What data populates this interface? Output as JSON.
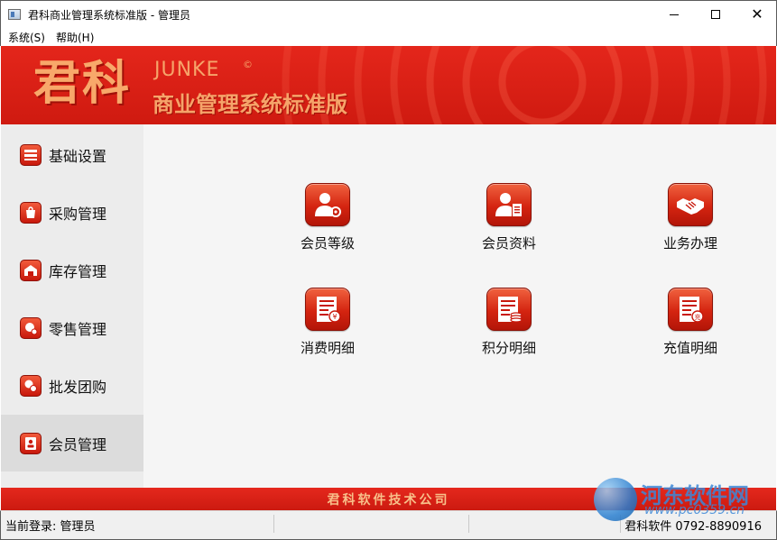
{
  "window": {
    "title": "君科商业管理系统标准版 - 管理员",
    "minimize_icon": "minimize-icon",
    "maximize_icon": "maximize-icon",
    "close_icon": "close-icon"
  },
  "menubar": {
    "items": [
      {
        "label": "系统(S)"
      },
      {
        "label": "帮助(H)"
      }
    ]
  },
  "banner": {
    "logo_cn": "君科",
    "logo_en": "JUNKE",
    "logo_mark": "©",
    "subtitle": "商业管理系统标准版"
  },
  "sidebar": {
    "items": [
      {
        "label": "基础设置",
        "icon": "settings-icon",
        "active": false
      },
      {
        "label": "采购管理",
        "icon": "purchase-icon",
        "active": false
      },
      {
        "label": "库存管理",
        "icon": "warehouse-icon",
        "active": false
      },
      {
        "label": "零售管理",
        "icon": "retail-icon",
        "active": false
      },
      {
        "label": "批发团购",
        "icon": "wholesale-icon",
        "active": false
      },
      {
        "label": "会员管理",
        "icon": "member-icon",
        "active": true
      }
    ]
  },
  "main": {
    "tiles": [
      {
        "label": "会员等级",
        "icon": "member-level-icon"
      },
      {
        "label": "会员资料",
        "icon": "member-profile-icon"
      },
      {
        "label": "业务办理",
        "icon": "handshake-icon"
      },
      {
        "label": "消费明细",
        "icon": "consumption-detail-icon"
      },
      {
        "label": "积分明细",
        "icon": "points-detail-icon"
      },
      {
        "label": "充值明细",
        "icon": "recharge-detail-icon"
      }
    ]
  },
  "footer": {
    "company": "君科软件技术公司"
  },
  "statusbar": {
    "login": "当前登录: 管理员",
    "contact": "君科软件 0792-8890916"
  },
  "watermark": {
    "text": "河东软件网",
    "url": "www.pc0359.cn"
  },
  "colors": {
    "brand_red": "#d42410",
    "logo_orange": "#f6a46a",
    "sidebar_bg": "#ececec",
    "main_bg": "#f5f5f5"
  }
}
